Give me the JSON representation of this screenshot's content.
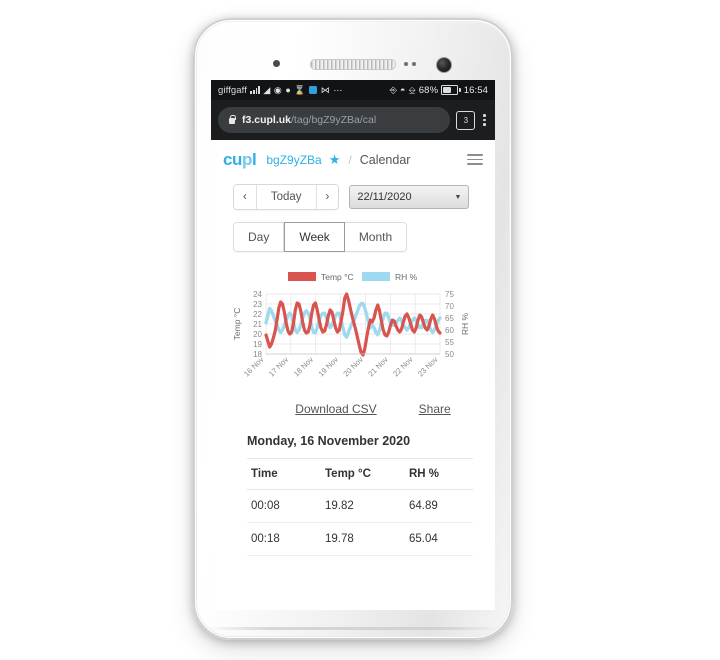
{
  "status_bar": {
    "carrier": "giffgaff",
    "battery_percent": "68%",
    "clock": "16:54",
    "icons": [
      "signal-icon",
      "wifi-icon",
      "do-not-disturb-icon",
      "data-saver-icon",
      "download-icon",
      "app-notification-icon",
      "mail-icon",
      "more-notifications-icon",
      "nfc-icon",
      "bluetooth-icon",
      "vibrate-icon",
      "battery-icon"
    ]
  },
  "browser": {
    "url_host": "f3.cupl.uk",
    "url_path": "/tag/bgZ9yZBa/cal",
    "tab_count": "3",
    "lock_icon": "lock-icon",
    "menu_icon": "kebab-menu-icon"
  },
  "appbar": {
    "logo_a": "cu",
    "logo_b": "p",
    "logo_c": "l",
    "tag": "bgZ9yZBa",
    "star": "★",
    "separator": "/",
    "section": "Calendar",
    "menu_icon": "hamburger-menu-icon"
  },
  "nav": {
    "prev": "‹",
    "today": "Today",
    "next": "›",
    "date_value": "22/11/2020",
    "caret": "▼"
  },
  "range_tabs": [
    {
      "label": "Day",
      "selected": false
    },
    {
      "label": "Week",
      "selected": true
    },
    {
      "label": "Month",
      "selected": false
    }
  ],
  "links": {
    "download": "Download CSV",
    "share": "Share"
  },
  "day_title": "Monday, 16 November 2020",
  "table": {
    "headers": [
      "Time",
      "Temp °C",
      "RH %"
    ],
    "rows": [
      [
        "00:08",
        "19.82",
        "64.89"
      ],
      [
        "00:18",
        "19.78",
        "65.04"
      ]
    ]
  },
  "colors": {
    "temp": "#d9534f",
    "rh": "#9fd9f0",
    "brand": "#2eb0e4",
    "grid": "#e3e3e3",
    "axis_text": "#8a8a8a"
  },
  "chart_data": {
    "type": "line",
    "title": "",
    "xlabel": "",
    "ylabel": "Temp °C",
    "y2label": "RH %",
    "ylim": [
      18,
      24
    ],
    "y2lim": [
      50,
      75
    ],
    "yticks": [
      18,
      19,
      20,
      21,
      22,
      23,
      24
    ],
    "y2ticks": [
      50,
      55,
      60,
      65,
      70,
      75
    ],
    "categories": [
      "16 Nov",
      "17 Nov",
      "18 Nov",
      "19 Nov",
      "20 Nov",
      "21 Nov",
      "22 Nov",
      "23 Nov"
    ],
    "grid": true,
    "legend_position": "top",
    "series": [
      {
        "name": "Temp °C",
        "color": "#d9534f",
        "axis": "left",
        "values": [
          19.9,
          19.3,
          18.7,
          19.0,
          19.6,
          20.3,
          21.4,
          22.6,
          23.2,
          23.0,
          22.2,
          21.1,
          20.3,
          20.0,
          20.2,
          21.1,
          22.4,
          23.1,
          23.0,
          22.3,
          21.2,
          20.4,
          20.1,
          20.2,
          20.9,
          22.1,
          22.9,
          23.1,
          22.4,
          21.4,
          20.6,
          20.2,
          20.3,
          20.9,
          21.8,
          22.4,
          22.2,
          21.4,
          20.6,
          20.2,
          20.4,
          21.3,
          22.3,
          23.6,
          24.0,
          23.4,
          22.6,
          21.8,
          21.1,
          20.4,
          19.6,
          18.8,
          18.1,
          17.9,
          18.6,
          19.7,
          20.7,
          21.4,
          21.2,
          21.6,
          22.4,
          22.9,
          22.3,
          21.3,
          20.4,
          19.9,
          19.8,
          20.2,
          20.9,
          21.4,
          21.3,
          20.8,
          20.4,
          20.2,
          20.5,
          21.2,
          21.8,
          22.0,
          21.6,
          21.0,
          20.4,
          20.2,
          20.6,
          21.4,
          21.9,
          21.7,
          21.1,
          20.6,
          20.4,
          20.8,
          21.5,
          21.9,
          21.5,
          20.8,
          20.3,
          20.1
        ]
      },
      {
        "name": "RH %",
        "color": "#9fd9f0",
        "axis": "right",
        "values": [
          63,
          66,
          69,
          68,
          66,
          64,
          62,
          60,
          59,
          60,
          62,
          64,
          66,
          67,
          66,
          63,
          60,
          59,
          60,
          62,
          65,
          67,
          68,
          67,
          65,
          61,
          59,
          59,
          61,
          64,
          66,
          67,
          67,
          65,
          63,
          61,
          62,
          64,
          66,
          67,
          67,
          64,
          61,
          58,
          57,
          59,
          61,
          63,
          64,
          66,
          68,
          70,
          71,
          71,
          69,
          66,
          63,
          61,
          62,
          61,
          59,
          58,
          60,
          63,
          65,
          67,
          67,
          65,
          63,
          62,
          62,
          63,
          64,
          65,
          64,
          62,
          61,
          60,
          61,
          63,
          64,
          65,
          64,
          62,
          61,
          61,
          63,
          64,
          64,
          62,
          60,
          59,
          60,
          62,
          64,
          65
        ]
      }
    ]
  }
}
